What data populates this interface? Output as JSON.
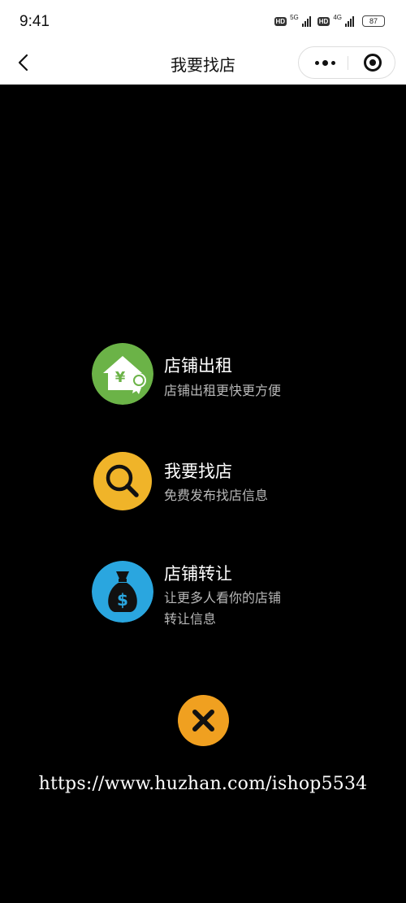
{
  "status_bar": {
    "time": "9:41",
    "hd1": "HD",
    "network1": "5G",
    "hd2": "HD",
    "network2": "4G",
    "battery": "87"
  },
  "nav": {
    "title": "我要找店",
    "back_icon": "chevron-left-icon",
    "more_icon": "more-dots-icon",
    "close_icon": "target-circle-icon"
  },
  "menu": [
    {
      "title": "店铺出租",
      "desc_lines": [
        "店铺出租更快更方便"
      ],
      "icon": "house-yen-icon",
      "color": "#6bb347"
    },
    {
      "title": "我要找店",
      "desc_lines": [
        "免费发布找店信息"
      ],
      "icon": "search-icon",
      "color": "#f0b429"
    },
    {
      "title": "店铺转让",
      "desc_lines": [
        "让更多人看你的店铺",
        "转让信息"
      ],
      "icon": "money-bag-icon",
      "color": "#2aa6df"
    }
  ],
  "close_button": {
    "icon": "close-icon",
    "color": "#f0a020"
  },
  "watermark": "https://www.huzhan.com/ishop5534"
}
